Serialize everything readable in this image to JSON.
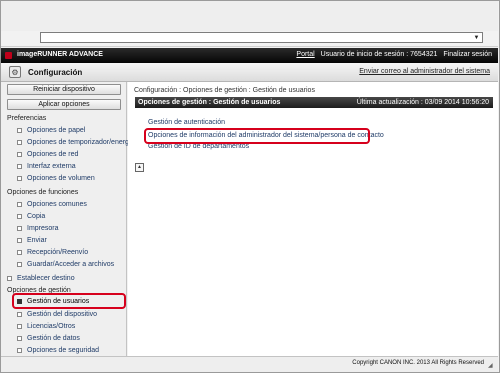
{
  "brand": {
    "product_name": "imageRUNNER ADVANCE"
  },
  "topbar": {
    "portal_label": "Portal",
    "user_text": "Usuario de inicio de sesión : 7654321",
    "logout_label": "Finalizar sesión"
  },
  "header": {
    "title": "Configuración",
    "email_link": "Enviar correo al administrador del sistema"
  },
  "sidebar": {
    "restart_button": "Reiniciar dispositivo",
    "apply_button": "Aplicar opciones",
    "group_preferencias": "Preferencias",
    "items_pref": [
      {
        "label": "Opciones de papel"
      },
      {
        "label": "Opciones de temporizador/energía"
      },
      {
        "label": "Opciones de red"
      },
      {
        "label": "Interfaz externa"
      },
      {
        "label": "Opciones de volumen"
      }
    ],
    "group_funciones": "Opciones de funciones",
    "items_func": [
      {
        "label": "Opciones comunes"
      },
      {
        "label": "Copia"
      },
      {
        "label": "Impresora"
      },
      {
        "label": "Enviar"
      },
      {
        "label": "Recepción/Reenvío"
      },
      {
        "label": "Guardar/Acceder a archivos"
      }
    ],
    "establecer_destino": "Establecer destino",
    "group_gestion": "Opciones de gestión",
    "items_gest": [
      {
        "label": "Gestión de usuarios"
      },
      {
        "label": "Gestión del dispositivo"
      },
      {
        "label": "Licencias/Otros"
      },
      {
        "label": "Gestión de datos"
      },
      {
        "label": "Opciones de seguridad"
      }
    ]
  },
  "main": {
    "breadcrumb": "Configuración : Opciones de gestión : Gestión de usuarios",
    "section_title": "Opciones de gestión : Gestión de usuarios",
    "last_updated": "Última actualización : 03/09 2014 10:56:20",
    "links": [
      {
        "label": "Gestión de autenticación"
      },
      {
        "label": "Opciones de información del administrador del sistema/persona de contacto"
      },
      {
        "label": "Gestión de ID de departamentos"
      }
    ]
  },
  "footer": {
    "copyright": "Copyright CANON INC. 2013 All Rights Reserved"
  },
  "colors": {
    "highlight": "#d6001c",
    "banner": "#111111",
    "link": "#1f3b67"
  }
}
